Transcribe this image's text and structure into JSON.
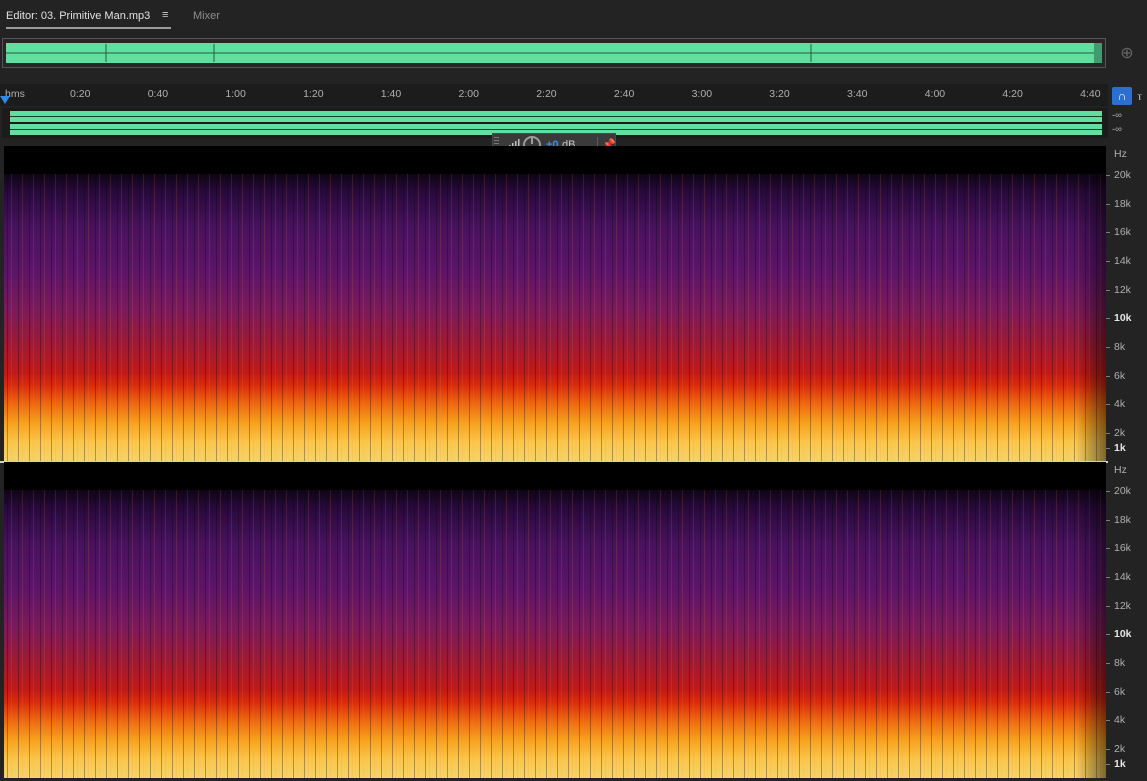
{
  "tabs": {
    "editor_label": "Editor: 03. Primitive Man.mp3",
    "mixer_label": "Mixer"
  },
  "icons": {
    "panel_menu": "hamburger-menu-icon",
    "zoom_nav": "zoom-navigator-icon",
    "snap": "magnet-snap-icon",
    "marker": "marker-icon",
    "hud_meter": "level-meter-icon",
    "hud_knob": "volume-knob-icon",
    "hud_pin": "pin-icon"
  },
  "ruler": {
    "unit": "hms",
    "labels": [
      "0:20",
      "0:40",
      "1:00",
      "1:20",
      "1:40",
      "2:00",
      "2:20",
      "2:40",
      "3:00",
      "3:20",
      "3:40",
      "4:00",
      "4:20",
      "4:40"
    ]
  },
  "waveform": {
    "channel_levels": [
      "-∞",
      "-∞"
    ],
    "color": "#5fe0a0"
  },
  "hud": {
    "value": "+0",
    "unit": "dB"
  },
  "spectral": {
    "axis_unit": "Hz",
    "labels": [
      "20k",
      "18k",
      "16k",
      "14k",
      "12k",
      "10k",
      "8k",
      "6k",
      "4k",
      "2k",
      "1k"
    ],
    "bold_labels": [
      "10k",
      "1k"
    ]
  },
  "colors": {
    "accent": "#2b6fd1",
    "hud_value": "#3d8eea"
  }
}
